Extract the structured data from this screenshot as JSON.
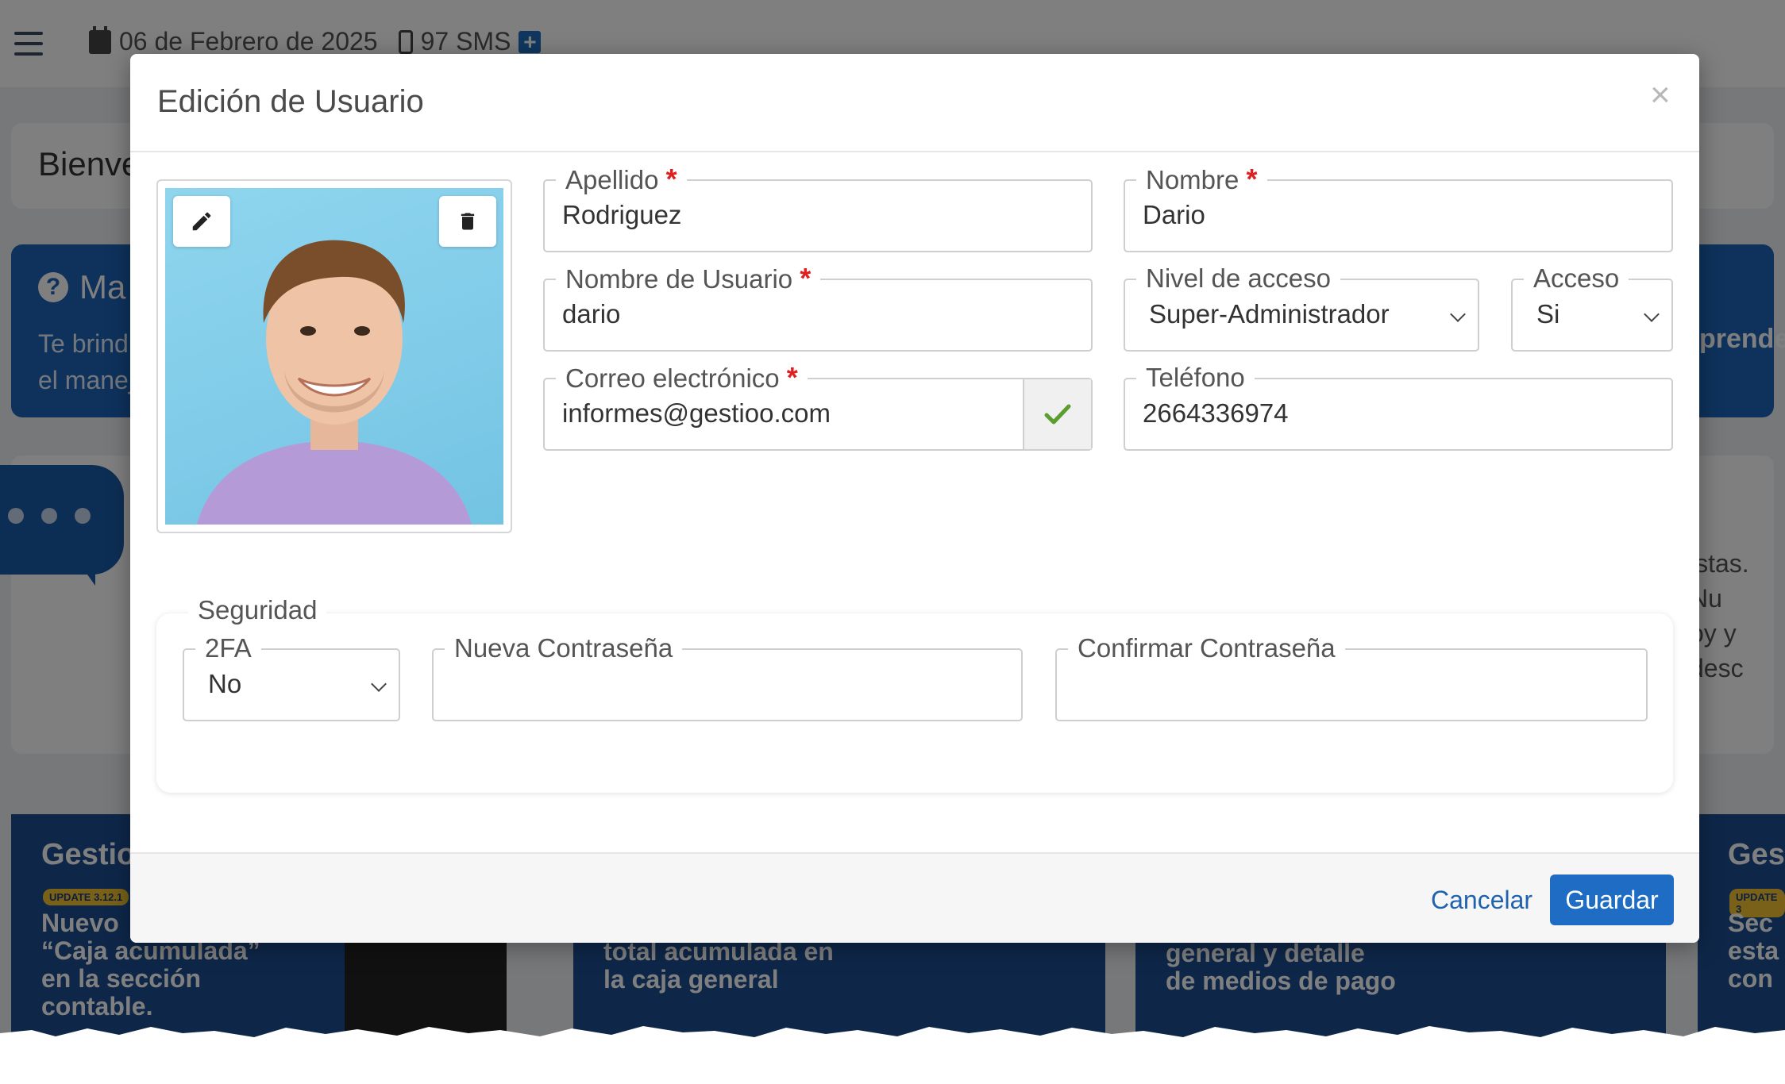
{
  "background": {
    "date": "06 de Febrero de 2025",
    "sms": "97 SMS",
    "welcome": "Bienve",
    "help_title": "Ma",
    "help_line1": "Te brind",
    "help_line2": "el manej",
    "right_blue": "prende",
    "right_line1": "istas. Nu",
    "right_line2": "oy y desc",
    "promo1": {
      "brand": "Gestio",
      "badge": "UPDATE 3.12.1",
      "line1": "Nuevo",
      "line2": "“Caja acumulada”",
      "line3": "en la sección",
      "line4": "contable."
    },
    "promo2": {
      "line1": "total acumulada en",
      "line2": "la caja general"
    },
    "promo3": {
      "line1": "general y detalle",
      "line2": "de medios de pago"
    },
    "promo4": {
      "brand": "Ges",
      "badge": "UPDATE 3",
      "line1": "Sec",
      "line2": "esta",
      "line3": "con"
    }
  },
  "modal": {
    "title": "Edición de Usuario",
    "close": "×",
    "photo": {
      "edit_icon": "pencil-icon",
      "delete_icon": "trash-icon"
    },
    "fields": {
      "apellido": {
        "label": "Apellido",
        "value": "Rodriguez",
        "required": "*"
      },
      "nombre": {
        "label": "Nombre",
        "value": "Dario",
        "required": "*"
      },
      "usuario": {
        "label": "Nombre de Usuario",
        "value": "dario",
        "required": "*"
      },
      "nivel": {
        "label": "Nivel de acceso",
        "value": "Super-Administrador"
      },
      "acceso": {
        "label": "Acceso",
        "value": "Si"
      },
      "correo": {
        "label": "Correo electrónico",
        "value": "informes@gestioo.com",
        "required": "*"
      },
      "telefono": {
        "label": "Teléfono",
        "value": "2664336974"
      }
    },
    "security": {
      "legend": "Seguridad",
      "twofa": {
        "label": "2FA",
        "value": "No"
      },
      "new_password": {
        "label": "Nueva Contraseña",
        "value": ""
      },
      "confirm_password": {
        "label": "Confirmar Contraseña",
        "value": ""
      }
    },
    "footer": {
      "cancel": "Cancelar",
      "save": "Guardar"
    }
  },
  "colors": {
    "primary": "#1e6cc4",
    "required": "#e02020",
    "check": "#5a9e2f"
  }
}
